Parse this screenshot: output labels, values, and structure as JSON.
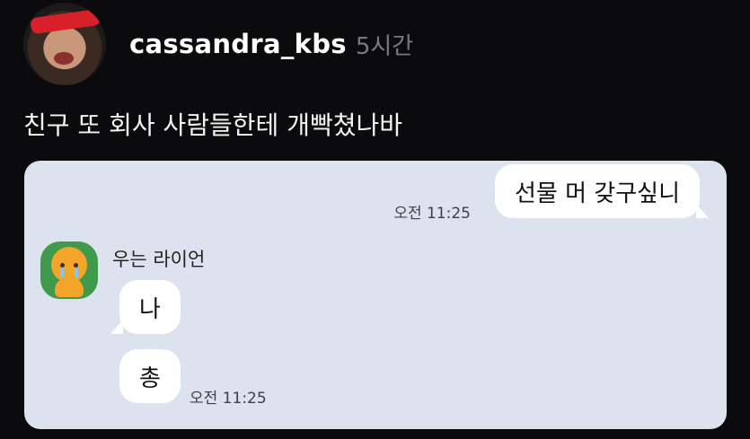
{
  "post": {
    "username": "cassandra_kbs",
    "time_ago": "5시간",
    "text": "친구 또 회사 사람들한테 개빡쳤나바"
  },
  "chat": {
    "outgoing": {
      "message": "선물 머 갖구싶니",
      "time": "오전 11:25"
    },
    "friend": {
      "name": "우는 라이언",
      "messages": [
        "나",
        "총"
      ],
      "time": "오전 11:25"
    },
    "colors": {
      "background": "#dce3ee",
      "bubble": "#ffffff",
      "friend_avatar_bg": "#3f9a4b"
    }
  }
}
